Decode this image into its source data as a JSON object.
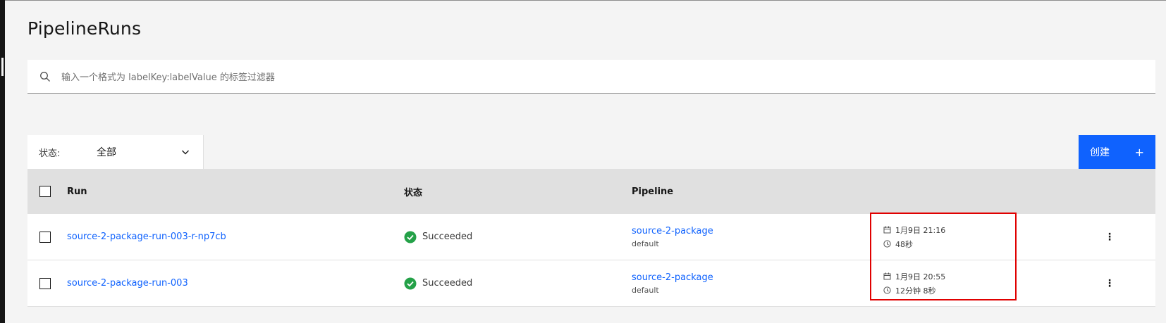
{
  "page": {
    "title": "PipelineRuns"
  },
  "search": {
    "placeholder": "输入一个格式为 labelKey:labelValue 的标签过滤器",
    "icon": "search-icon"
  },
  "filter": {
    "label": "状态:",
    "value": "全部",
    "icon": "chevron-down-icon"
  },
  "toolbar": {
    "create_label": "创建",
    "create_icon": "plus-icon"
  },
  "table": {
    "columns": {
      "run": "Run",
      "status": "状态",
      "pipeline": "Pipeline"
    },
    "rows": [
      {
        "run": "source-2-package-run-003-r-np7cb",
        "status": "Succeeded",
        "pipeline": "source-2-package",
        "namespace": "default",
        "started": "1月9日 21:16",
        "duration": "48秒"
      },
      {
        "run": "source-2-package-run-003",
        "status": "Succeeded",
        "pipeline": "source-2-package",
        "namespace": "default",
        "started": "1月9日 20:55",
        "duration": "12分钟 8秒"
      }
    ]
  },
  "colors": {
    "accent": "#0f62fe",
    "success": "#24a148",
    "highlight": "#e00000"
  }
}
